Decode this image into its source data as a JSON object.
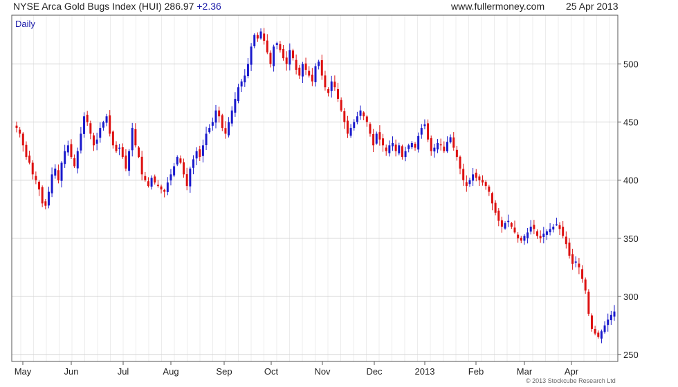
{
  "header": {
    "title": "NYSE Arca Gold Bugs Index (HUI) 286.97",
    "change": "+2.36",
    "site": "www.fullermoney.com",
    "date": "25 Apr 2013"
  },
  "chart_data": {
    "type": "candlestick",
    "title": "NYSE Arca Gold Bugs Index (HUI) 286.97 +2.36",
    "period_label": "Daily",
    "ylim": [
      244,
      542
    ],
    "yticks": [
      250,
      300,
      350,
      400,
      450,
      500
    ],
    "xlabels": [
      "May",
      "Jun",
      "Jul",
      "Aug",
      "Sep",
      "Oct",
      "Nov",
      "Dec",
      "2013",
      "Feb",
      "Mar",
      "Apr"
    ],
    "grid": true,
    "up_color": "#1a1acc",
    "down_color": "#dd1111",
    "close_series": [
      445,
      440,
      430,
      420,
      415,
      405,
      400,
      392,
      380,
      378,
      390,
      405,
      410,
      400,
      415,
      425,
      430,
      420,
      412,
      425,
      440,
      455,
      450,
      440,
      430,
      435,
      445,
      450,
      455,
      440,
      430,
      425,
      428,
      420,
      410,
      425,
      445,
      430,
      420,
      405,
      400,
      395,
      402,
      398,
      395,
      392,
      390,
      398,
      405,
      412,
      420,
      415,
      405,
      395,
      410,
      418,
      425,
      420,
      430,
      440,
      445,
      450,
      460,
      455,
      445,
      440,
      450,
      460,
      470,
      480,
      485,
      490,
      500,
      515,
      525,
      522,
      528,
      520,
      510,
      500,
      515,
      518,
      512,
      505,
      500,
      512,
      505,
      495,
      490,
      500,
      495,
      490,
      485,
      498,
      502,
      490,
      480,
      475,
      485,
      480,
      470,
      460,
      450,
      440,
      445,
      450,
      455,
      460,
      455,
      450,
      440,
      430,
      440,
      435,
      430,
      425,
      430,
      432,
      425,
      430,
      420,
      425,
      430,
      432,
      428,
      438,
      445,
      448,
      435,
      425,
      428,
      432,
      430,
      425,
      433,
      437,
      428,
      420,
      410,
      400,
      395,
      400,
      405,
      402,
      400,
      398,
      395,
      390,
      380,
      372,
      365,
      360,
      363,
      365,
      360,
      355,
      350,
      348,
      352,
      355,
      360,
      358,
      352,
      350,
      354,
      356,
      358,
      360,
      362,
      358,
      352,
      345,
      335,
      328,
      330,
      325,
      315,
      305,
      285,
      272,
      268,
      265,
      270,
      275,
      280,
      284,
      287
    ],
    "annotation": "© 2013 Stockcube Research Ltd"
  },
  "colors": {
    "grid": "#d4d4d4",
    "minor_grid": "#ececec",
    "frame": "#555555",
    "label_blue": "#1a1aa8"
  }
}
